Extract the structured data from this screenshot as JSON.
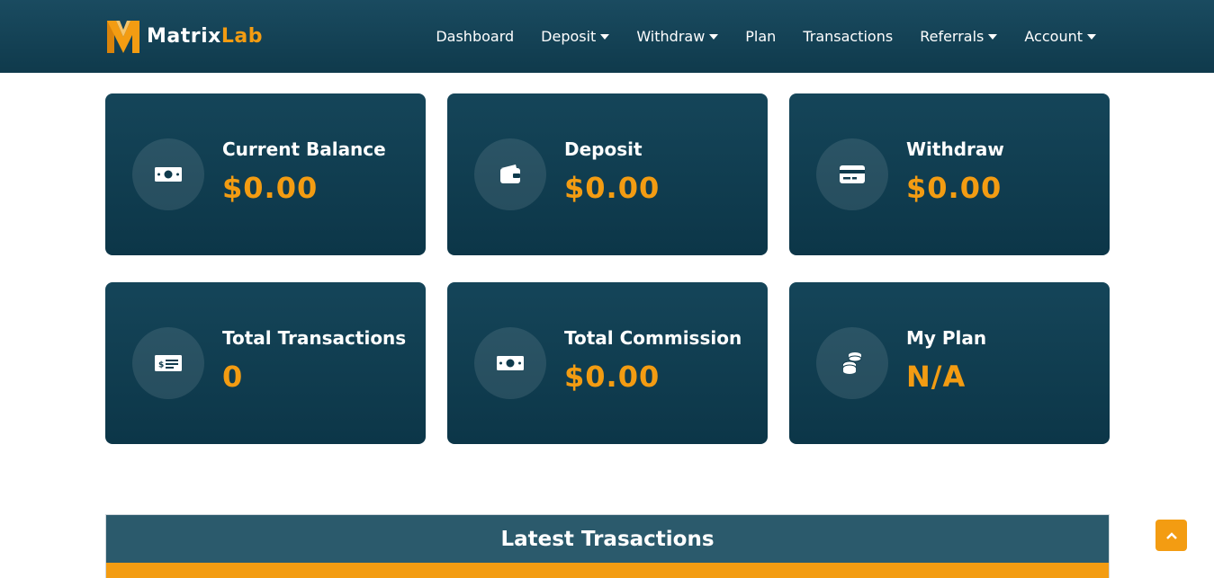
{
  "brand": {
    "name_part1": "Matrix",
    "name_part2": "Lab",
    "accent": "#f39c12",
    "nav_bg": "#0f3a4c"
  },
  "nav": {
    "items": [
      {
        "label": "Dashboard",
        "dropdown": false
      },
      {
        "label": "Deposit",
        "dropdown": true
      },
      {
        "label": "Withdraw",
        "dropdown": true
      },
      {
        "label": "Plan",
        "dropdown": false
      },
      {
        "label": "Transactions",
        "dropdown": false
      },
      {
        "label": "Referrals",
        "dropdown": true
      },
      {
        "label": "Account",
        "dropdown": true
      }
    ]
  },
  "stats": [
    {
      "label": "Current Balance",
      "value": "$0.00",
      "icon": "money-bill-icon"
    },
    {
      "label": "Deposit",
      "value": "$0.00",
      "icon": "wallet-icon"
    },
    {
      "label": "Withdraw",
      "value": "$0.00",
      "icon": "credit-card-icon"
    },
    {
      "label": "Total Transactions",
      "value": "0",
      "icon": "money-check-icon"
    },
    {
      "label": "Total Commission",
      "value": "$0.00",
      "icon": "money-bill-icon"
    },
    {
      "label": "My Plan",
      "value": "N/A",
      "icon": "coins-icon"
    }
  ],
  "transactions": {
    "title": "Latest Trasactions"
  },
  "scroll_top": {
    "icon": "chevron-up-icon"
  }
}
